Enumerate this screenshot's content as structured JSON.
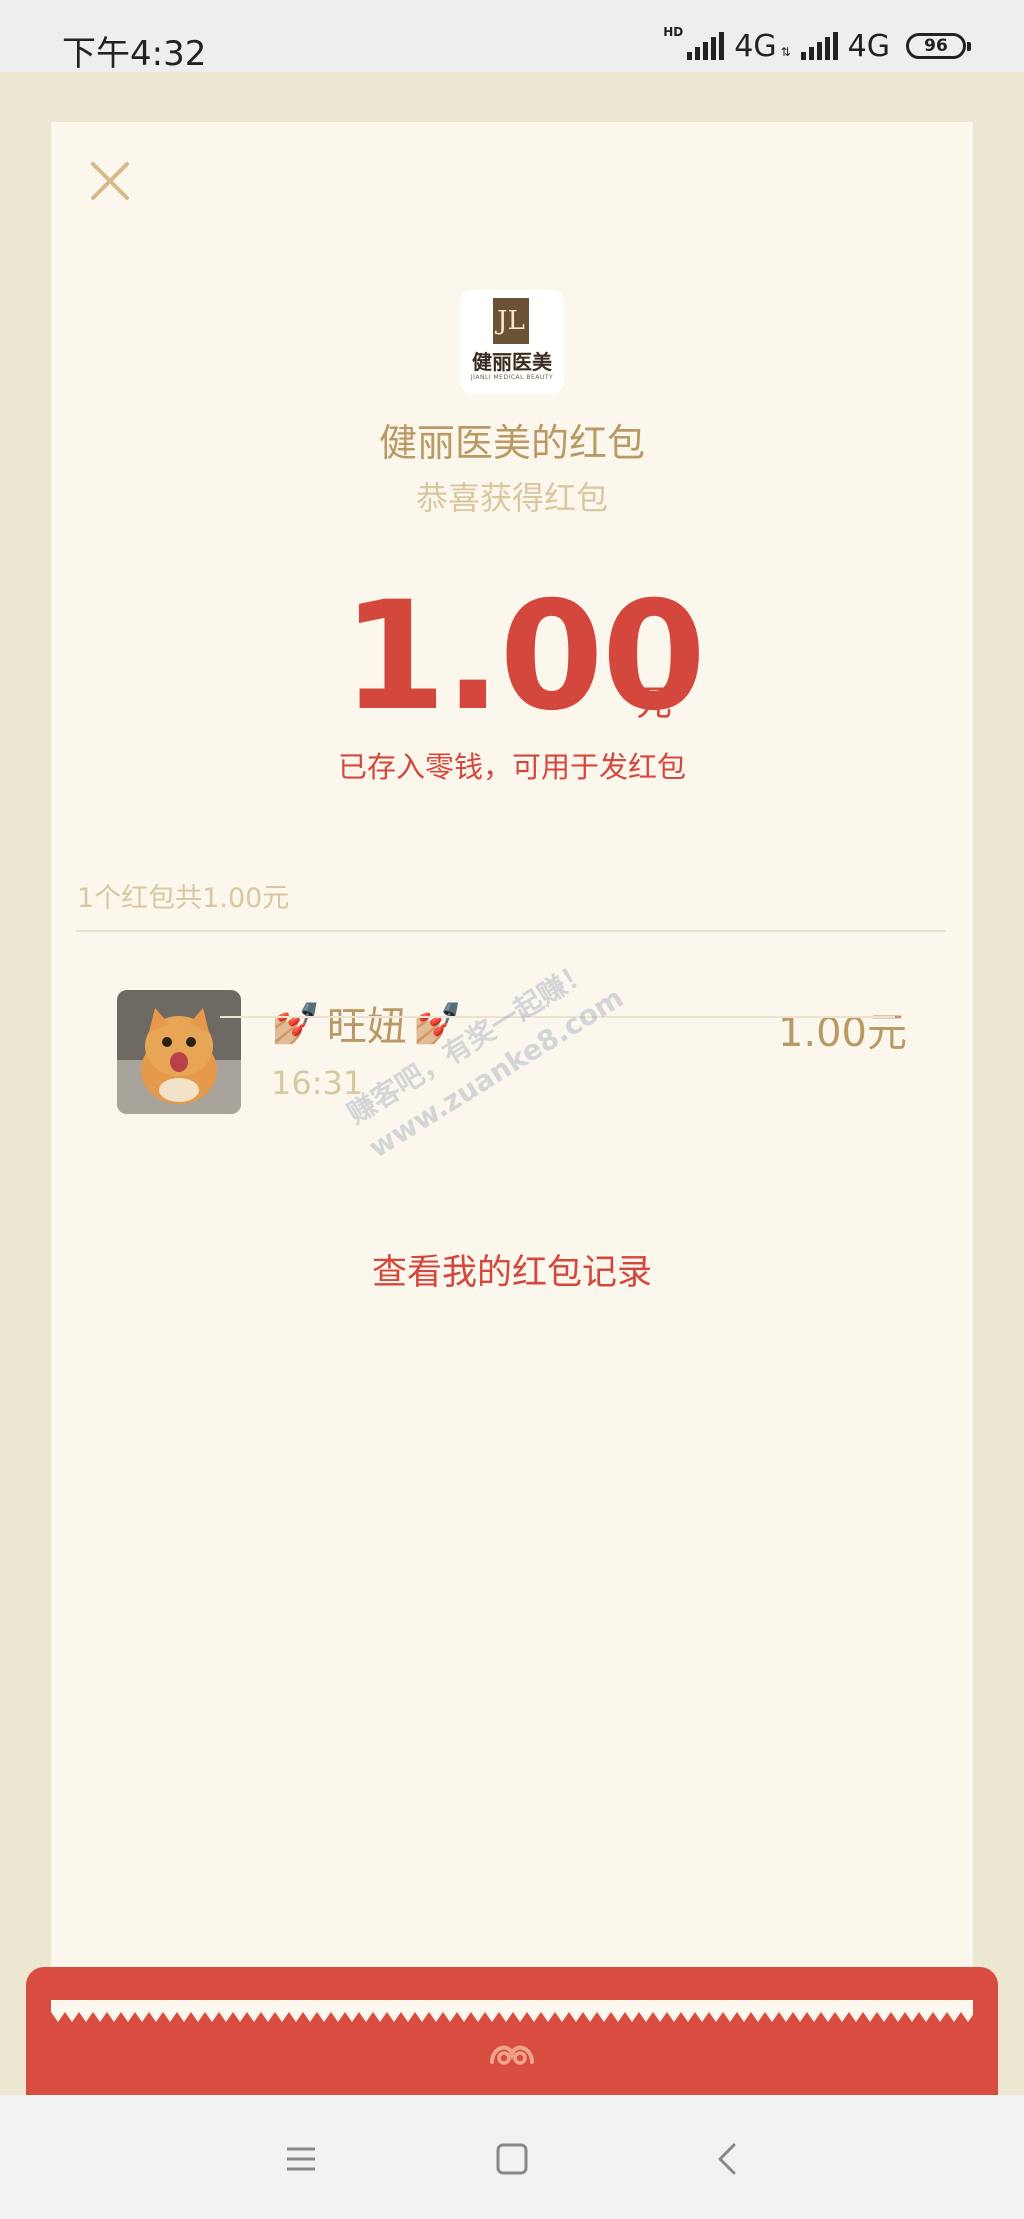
{
  "status_bar": {
    "time": "下午4:32",
    "hd": "HD",
    "network_1": "4G",
    "network_2": "4G",
    "battery": "96"
  },
  "packet": {
    "sender_logo_text": "健丽医美",
    "sender_logo_sub": "JIANLI MEDICAL BEAUTY",
    "title": "健丽医美的红包",
    "subtitle": "恭喜获得红包",
    "amount": "1.00",
    "amount_unit": "元",
    "saved_note": "已存入零钱，可用于发红包",
    "summary": "1个红包共1.00元"
  },
  "record": {
    "nail_emoji": "💅🏼",
    "nickname": "旺妞",
    "time": "16:31",
    "amount": "1.00元"
  },
  "watermark": {
    "line1": "赚客吧，有奖一起赚！",
    "line2": "www.zuanke8.com"
  },
  "actions": {
    "view_records": "查看我的红包记录"
  },
  "colors": {
    "accent_red": "#d4473d",
    "gold_text": "#b99a64",
    "light_gold": "#d8c79f",
    "card_bg": "#fbf7ec",
    "page_bg": "#ede6d1",
    "band_red": "#d94c40"
  },
  "icons": {
    "close": "close-icon",
    "menu": "menu-icon",
    "home": "home-icon",
    "back": "back-icon",
    "swirl": "cloud-swirl-icon"
  }
}
